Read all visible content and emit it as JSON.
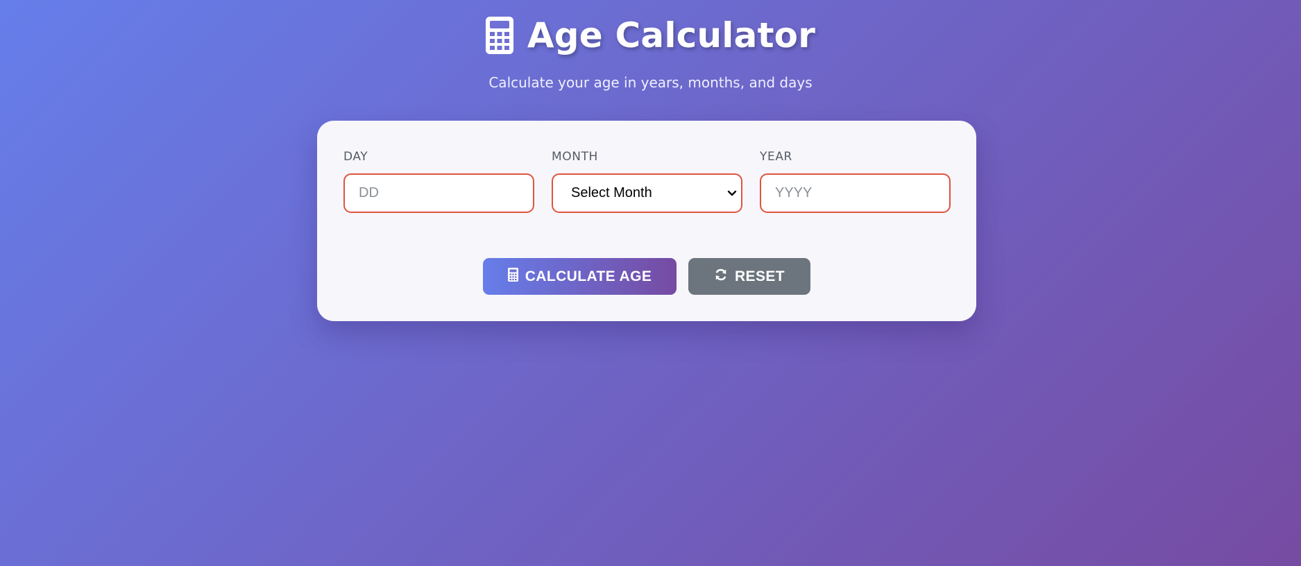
{
  "header": {
    "title": "Age Calculator",
    "subtitle": "Calculate your age in years, months, and days",
    "icon": "calculator-icon"
  },
  "form": {
    "day": {
      "label": "DAY",
      "placeholder": "DD",
      "value": ""
    },
    "month": {
      "label": "MONTH",
      "selected": "Select Month"
    },
    "year": {
      "label": "YEAR",
      "placeholder": "YYYY",
      "value": ""
    }
  },
  "buttons": {
    "calculate": {
      "label": "CALCULATE AGE",
      "icon": "calculator-icon"
    },
    "reset": {
      "label": "RESET",
      "icon": "refresh-icon"
    }
  },
  "colors": {
    "gradient_start": "#667eea",
    "gradient_end": "#764ba2",
    "card_background": "#f7f6fb",
    "input_border_error": "#e0533f",
    "reset_button": "#6c757d"
  }
}
